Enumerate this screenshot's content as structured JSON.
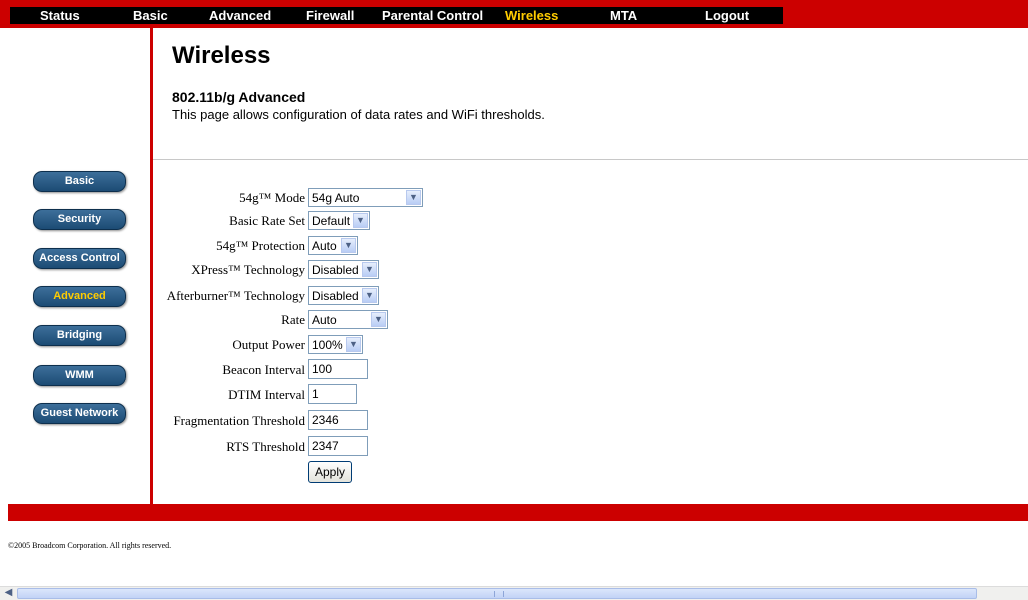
{
  "topnav": {
    "items": [
      "Status",
      "Basic",
      "Advanced",
      "Firewall",
      "Parental Control",
      "Wireless",
      "MTA",
      "Logout"
    ],
    "active": "Wireless"
  },
  "header": {
    "title": "Wireless",
    "subtitle": "802.11b/g Advanced",
    "description": "This page allows configuration of data rates and WiFi thresholds."
  },
  "sidebar": {
    "items": [
      "Basic",
      "Security",
      "Access Control",
      "Advanced",
      "Bridging",
      "WMM",
      "Guest Network"
    ],
    "active": "Advanced"
  },
  "form": {
    "mode": {
      "label": "54g™ Mode",
      "value": "54g Auto"
    },
    "basic_rate_set": {
      "label": "Basic Rate Set",
      "value": "Default"
    },
    "protection": {
      "label": "54g™ Protection",
      "value": "Auto"
    },
    "xpress": {
      "label": "XPress™ Technology",
      "value": "Disabled"
    },
    "afterburner": {
      "label": "Afterburner™ Technology",
      "value": "Disabled"
    },
    "rate": {
      "label": "Rate",
      "value": "Auto"
    },
    "output_power": {
      "label": "Output Power",
      "value": "100%"
    },
    "beacon_interval": {
      "label": "Beacon Interval",
      "value": "100"
    },
    "dtim_interval": {
      "label": "DTIM Interval",
      "value": "1"
    },
    "fragmentation_threshold": {
      "label": "Fragmentation Threshold",
      "value": "2346"
    },
    "rts_threshold": {
      "label": "RTS Threshold",
      "value": "2347"
    },
    "apply_label": "Apply"
  },
  "footer": {
    "copyright": "©2005 Broadcom Corporation. All rights reserved."
  },
  "colors": {
    "brand_red": "#cc0000",
    "nav_black": "#000000",
    "active_text": "#ffcc00",
    "button_blue": "#2a5a84"
  }
}
